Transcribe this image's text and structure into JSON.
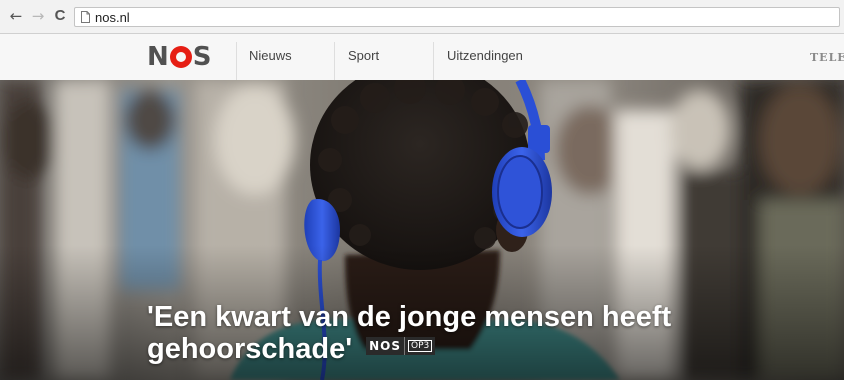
{
  "browser": {
    "back_icon": "←",
    "forward_icon": "→",
    "reload_icon": "C",
    "url": "nos.nl"
  },
  "header": {
    "logo_text": "NOS",
    "nav": [
      {
        "label": "Nieuws"
      },
      {
        "label": "Sport"
      },
      {
        "label": "Uitzendingen"
      }
    ],
    "teletekst_label": "TELETEKST"
  },
  "hero": {
    "headline_line1": "'Een kwart van de jonge mensen heeft",
    "headline_line2": "gehoorschade'",
    "badge_brand": "NOS",
    "badge_channel": "OP3"
  },
  "colors": {
    "brand_red": "#e61e14",
    "headphones": "#2a4fd6"
  }
}
